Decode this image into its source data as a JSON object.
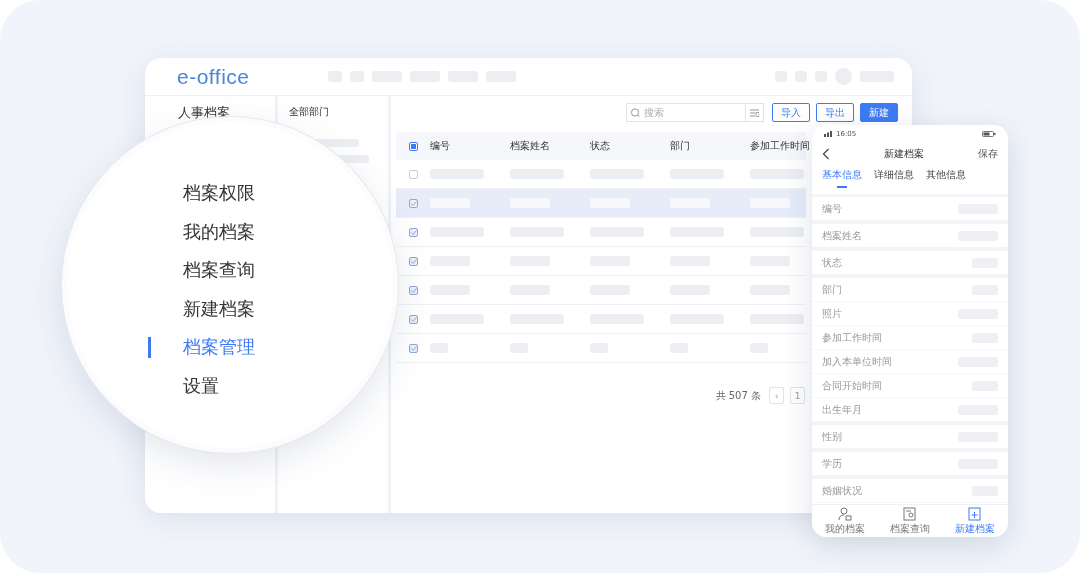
{
  "desktop": {
    "logo": "e-office",
    "sidebar_title": "人事档案",
    "dept_panel_title": "全部部门",
    "search": {
      "placeholder": "搜索"
    },
    "buttons": [
      {
        "label": "导入",
        "kind": "outline"
      },
      {
        "label": "导出",
        "kind": "outline"
      },
      {
        "label": "新建",
        "kind": "primary"
      }
    ],
    "table": {
      "header_checked": true,
      "columns": [
        "编号",
        "档案姓名",
        "状态",
        "部门",
        "参加工作时间"
      ],
      "rows": [
        {
          "checked": false,
          "selected": false,
          "kind": "long"
        },
        {
          "checked": true,
          "selected": true,
          "kind": "short"
        },
        {
          "checked": true,
          "selected": false,
          "kind": "long"
        },
        {
          "checked": true,
          "selected": false,
          "kind": "short"
        },
        {
          "checked": true,
          "selected": false,
          "kind": "short"
        },
        {
          "checked": true,
          "selected": false,
          "kind": "long"
        },
        {
          "checked": true,
          "selected": false,
          "kind": "tiny"
        }
      ]
    },
    "pagination": {
      "total": "共 507 条",
      "prev": "‹",
      "page": "1"
    }
  },
  "magnifier": {
    "items": [
      {
        "label": "档案权限",
        "selected": false
      },
      {
        "label": "我的档案",
        "selected": false
      },
      {
        "label": "档案查询",
        "selected": false
      },
      {
        "label": "新建档案",
        "selected": false
      },
      {
        "label": "档案管理",
        "selected": true
      },
      {
        "label": "设置",
        "selected": false
      }
    ]
  },
  "phone": {
    "time": "16:05",
    "title": "新建档案",
    "save": "保存",
    "tabs": [
      {
        "label": "基本信息",
        "selected": true
      },
      {
        "label": "详细信息",
        "selected": false
      },
      {
        "label": "其他信息",
        "selected": false
      }
    ],
    "fields": [
      {
        "label": "编号",
        "kind": "gap"
      },
      {
        "label": "档案姓名",
        "kind": "gap"
      },
      {
        "label": "状态",
        "kind": "gap"
      },
      {
        "label": "部门",
        "kind": "row"
      },
      {
        "label": "照片",
        "kind": "row"
      },
      {
        "label": "参加工作时间",
        "kind": "row"
      },
      {
        "label": "加入本单位时间",
        "kind": "row"
      },
      {
        "label": "合同开始时间",
        "kind": "row"
      },
      {
        "label": "出生年月",
        "kind": "gap"
      },
      {
        "label": "性别",
        "kind": "gap"
      },
      {
        "label": "学历",
        "kind": "gap"
      },
      {
        "label": "婚姻状况",
        "kind": "row"
      }
    ],
    "nav": [
      {
        "label": "我的档案",
        "kind": "person",
        "selected": false
      },
      {
        "label": "档案查询",
        "kind": "search",
        "selected": false
      },
      {
        "label": "新建档案",
        "kind": "add",
        "selected": true
      }
    ]
  }
}
